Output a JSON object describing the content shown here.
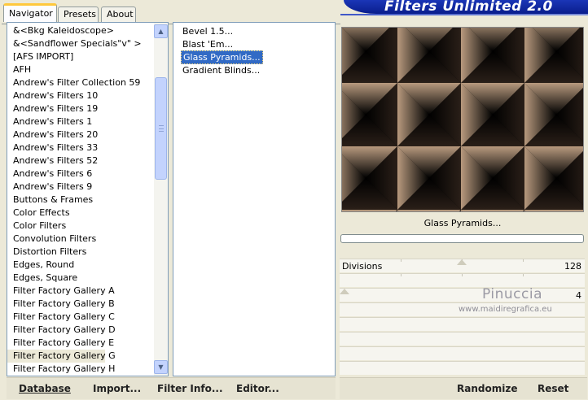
{
  "tabs": [
    {
      "label": "Navigator",
      "active": true
    },
    {
      "label": "Presets",
      "active": false
    },
    {
      "label": "About",
      "active": false
    }
  ],
  "banner": {
    "title": "Filters Unlimited 2.0"
  },
  "categories": [
    "&<Bkg Kaleidoscope>",
    "&<Sandflower Specials\"v\" >",
    "[AFS IMPORT]",
    "AFH",
    "Andrew's Filter Collection 59",
    "Andrew's Filters 10",
    "Andrew's Filters 19",
    "Andrew's Filters 1",
    "Andrew's Filters 20",
    "Andrew's Filters 33",
    "Andrew's Filters 52",
    "Andrew's Filters 6",
    "Andrew's Filters 9",
    "Buttons & Frames",
    "Color Effects",
    "Color Filters",
    "Convolution Filters",
    "Distortion Filters",
    "Edges, Round",
    "Edges, Square",
    "Filter Factory Gallery A",
    "Filter Factory Gallery B",
    "Filter Factory Gallery C",
    "Filter Factory Gallery D",
    "Filter Factory Gallery E",
    "Filter Factory Gallery G",
    "Filter Factory Gallery H"
  ],
  "selected_category": "Filter Factory Gallery G",
  "filters": [
    "Bevel 1.5...",
    "Blast 'Em...",
    "Glass Pyramids...",
    "Gradient Blinds..."
  ],
  "selected_filter": "Glass Pyramids...",
  "preview": {
    "label": "Glass Pyramids...",
    "progress": 0
  },
  "params": [
    {
      "label": "Divisions",
      "value": "128",
      "level": 0.5
    },
    {
      "label": "",
      "value": "4",
      "level": 0.0
    }
  ],
  "watermark": {
    "name": "Pinuccia",
    "url": "www.maidiregrafica.eu"
  },
  "buttons": {
    "database": "Database",
    "import": "Import...",
    "filter_info": "Filter Info...",
    "editor": "Editor...",
    "randomize": "Randomize",
    "reset": "Reset"
  },
  "colors": {
    "selection": "#316ac5",
    "banner": "#0a1d8c",
    "preview_highlight": "#b89a7e"
  }
}
